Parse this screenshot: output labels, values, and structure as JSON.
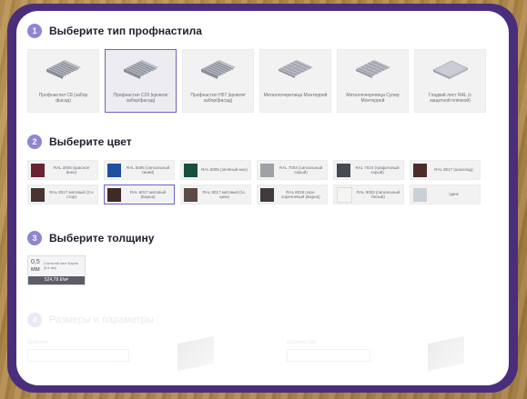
{
  "steps": [
    {
      "num": "1",
      "title": "Выберите тип профнастила"
    },
    {
      "num": "2",
      "title": "Выберите цвет"
    },
    {
      "num": "3",
      "title": "Выберите толщину"
    },
    {
      "num": "4",
      "title": "Размеры и параметры"
    }
  ],
  "types": [
    {
      "label": "Профнастил С8 (забор фасад)",
      "icon": "corrugated-sheet-icon"
    },
    {
      "label": "Профнастил С20 (кровля/забор/фасад)",
      "icon": "corrugated-sheet-icon",
      "selected": true
    },
    {
      "label": "Профнастил Н57 (кровля/забор/фасад)",
      "icon": "corrugated-sheet-icon"
    },
    {
      "label": "Металлочерепица Монтеррей",
      "icon": "metal-tile-icon"
    },
    {
      "label": "Металлочерепица Супер Монтеррей",
      "icon": "metal-tile-icon"
    },
    {
      "label": "Гладкий лист RAL (с защитной плёнкой)",
      "icon": "flat-sheet-icon"
    }
  ],
  "colors": [
    {
      "label": "RAL 3005 (красное вино)",
      "hex": "#6b2230"
    },
    {
      "label": "RAL 5005 (сигнальный синий)",
      "hex": "#1f4f9e"
    },
    {
      "label": "RAL 6005 (зелёный мох)",
      "hex": "#17503a"
    },
    {
      "label": "RAL 7004 (сигнальный серый)",
      "hex": "#9ea1a5"
    },
    {
      "label": "RAL 7024 (графитовый серый)",
      "hex": "#464a52"
    },
    {
      "label": "RAL 8017 (шоколад)",
      "hex": "#4a2d28"
    },
    {
      "label": "RAL 8017 матовый (2-х стор)",
      "hex": "#473530"
    },
    {
      "label": "RAL 8017 матовый (Барна)",
      "hex": "#3f2a28",
      "selected": true
    },
    {
      "label": "RAL 8017 матовый (1с. цинк)",
      "hex": "#5c4a44"
    },
    {
      "label": "RAL 8019 серо-коричневый (Барна)",
      "hex": "#403a3a"
    },
    {
      "label": "RAL 9003 (сигнальный белый)",
      "hex": "#f4f4f1"
    },
    {
      "label": "Цинк",
      "hex": "#c9d0d6"
    }
  ],
  "thickness": {
    "value": "0,5",
    "unit": "мм",
    "desc": "Стальной лист Барна (0,5 мм)",
    "price": "524,78 ₽/м²"
  },
  "dims": {
    "field1": "Ширина",
    "field2": "Количество"
  }
}
